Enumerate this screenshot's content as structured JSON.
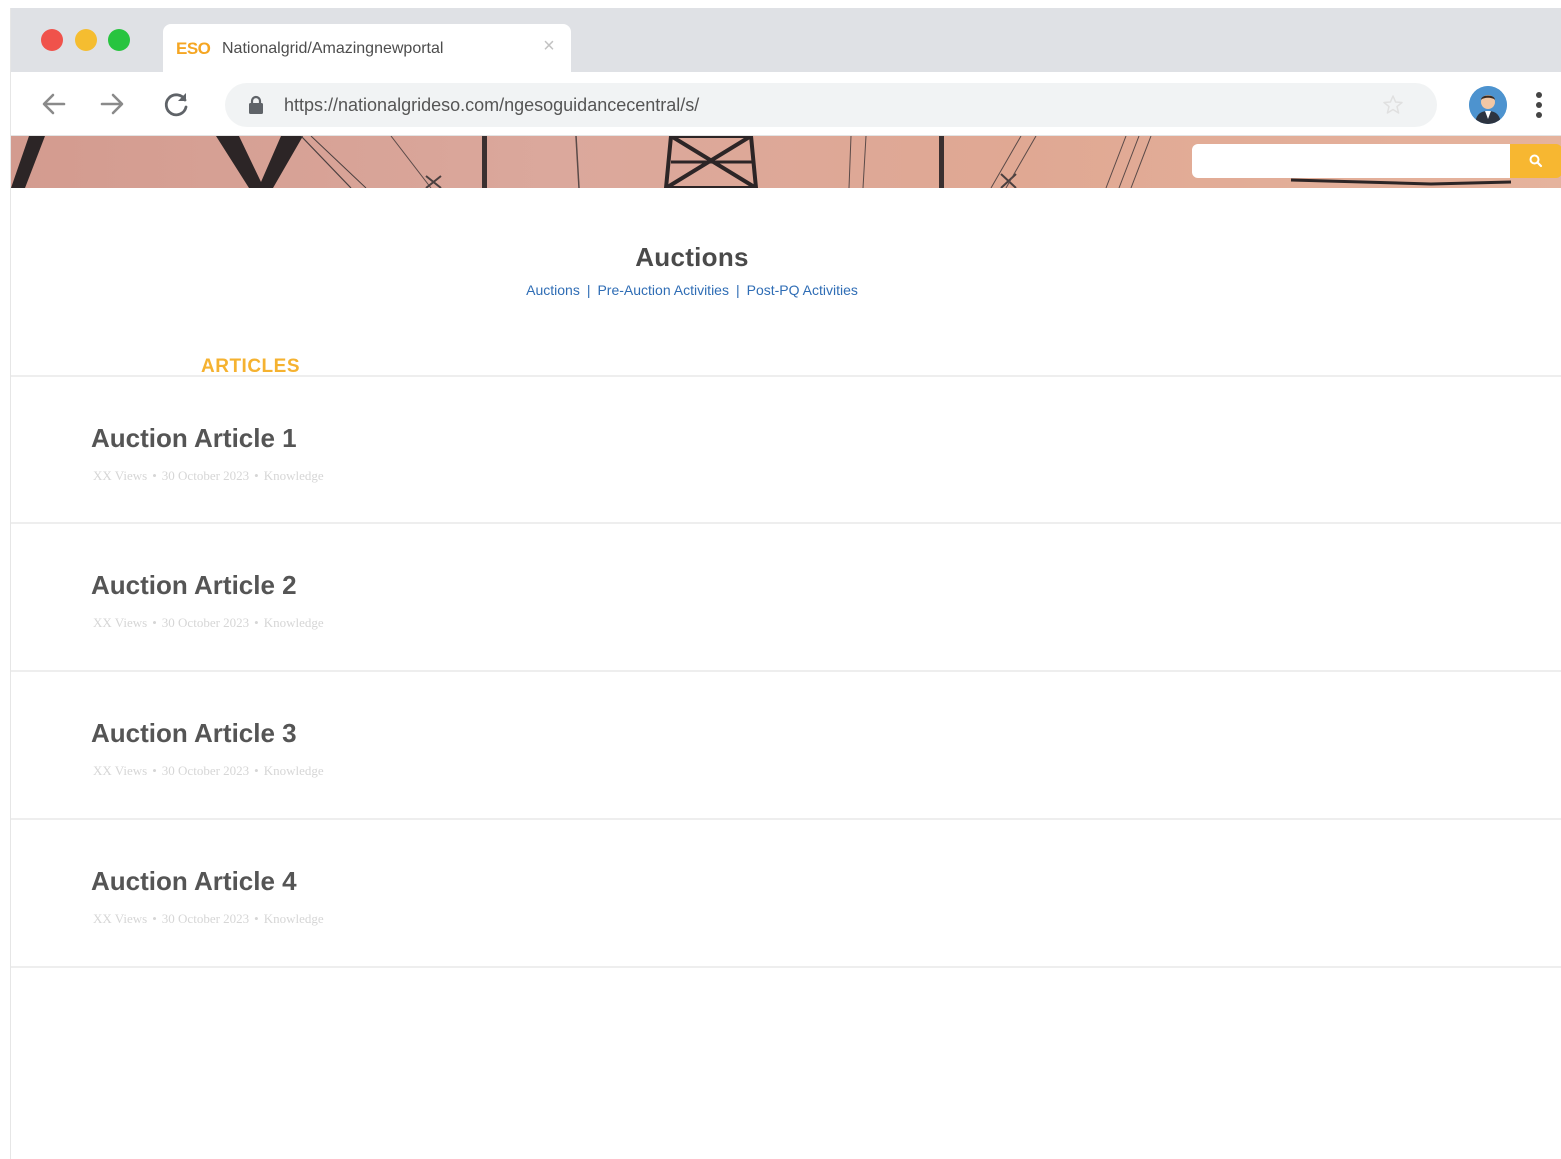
{
  "browser": {
    "tab": {
      "logo": "ESO",
      "title": "Nationalgrid/Amazingnewportal"
    },
    "url": "https://nationalgrideso.com/ngesoguidancecentral/s/"
  },
  "colors": {
    "accent": "#f5b230",
    "link": "#2f6db5",
    "title": "#4a4a4a"
  },
  "page": {
    "title": "Auctions",
    "breadcrumb": [
      "Auctions",
      "Pre-Auction Activities",
      "Post-PQ Activities"
    ],
    "section_label": "ARTICLES"
  },
  "articles": [
    {
      "title": "Auction Article 1",
      "views": "XX Views",
      "date": "30 October 2023",
      "type": "Knowledge"
    },
    {
      "title": "Auction Article 2",
      "views": "XX Views",
      "date": "30 October 2023",
      "type": "Knowledge"
    },
    {
      "title": "Auction Article 3",
      "views": "XX Views",
      "date": "30 October 2023",
      "type": "Knowledge"
    },
    {
      "title": "Auction Article 4",
      "views": "XX Views",
      "date": "30 October 2023",
      "type": "Knowledge"
    }
  ],
  "icons": {
    "back": "arrow-left-icon",
    "forward": "arrow-right-icon",
    "reload": "reload-icon",
    "lock": "lock-icon",
    "star": "star-icon",
    "menu": "vertical-dots-icon",
    "search": "search-icon"
  }
}
